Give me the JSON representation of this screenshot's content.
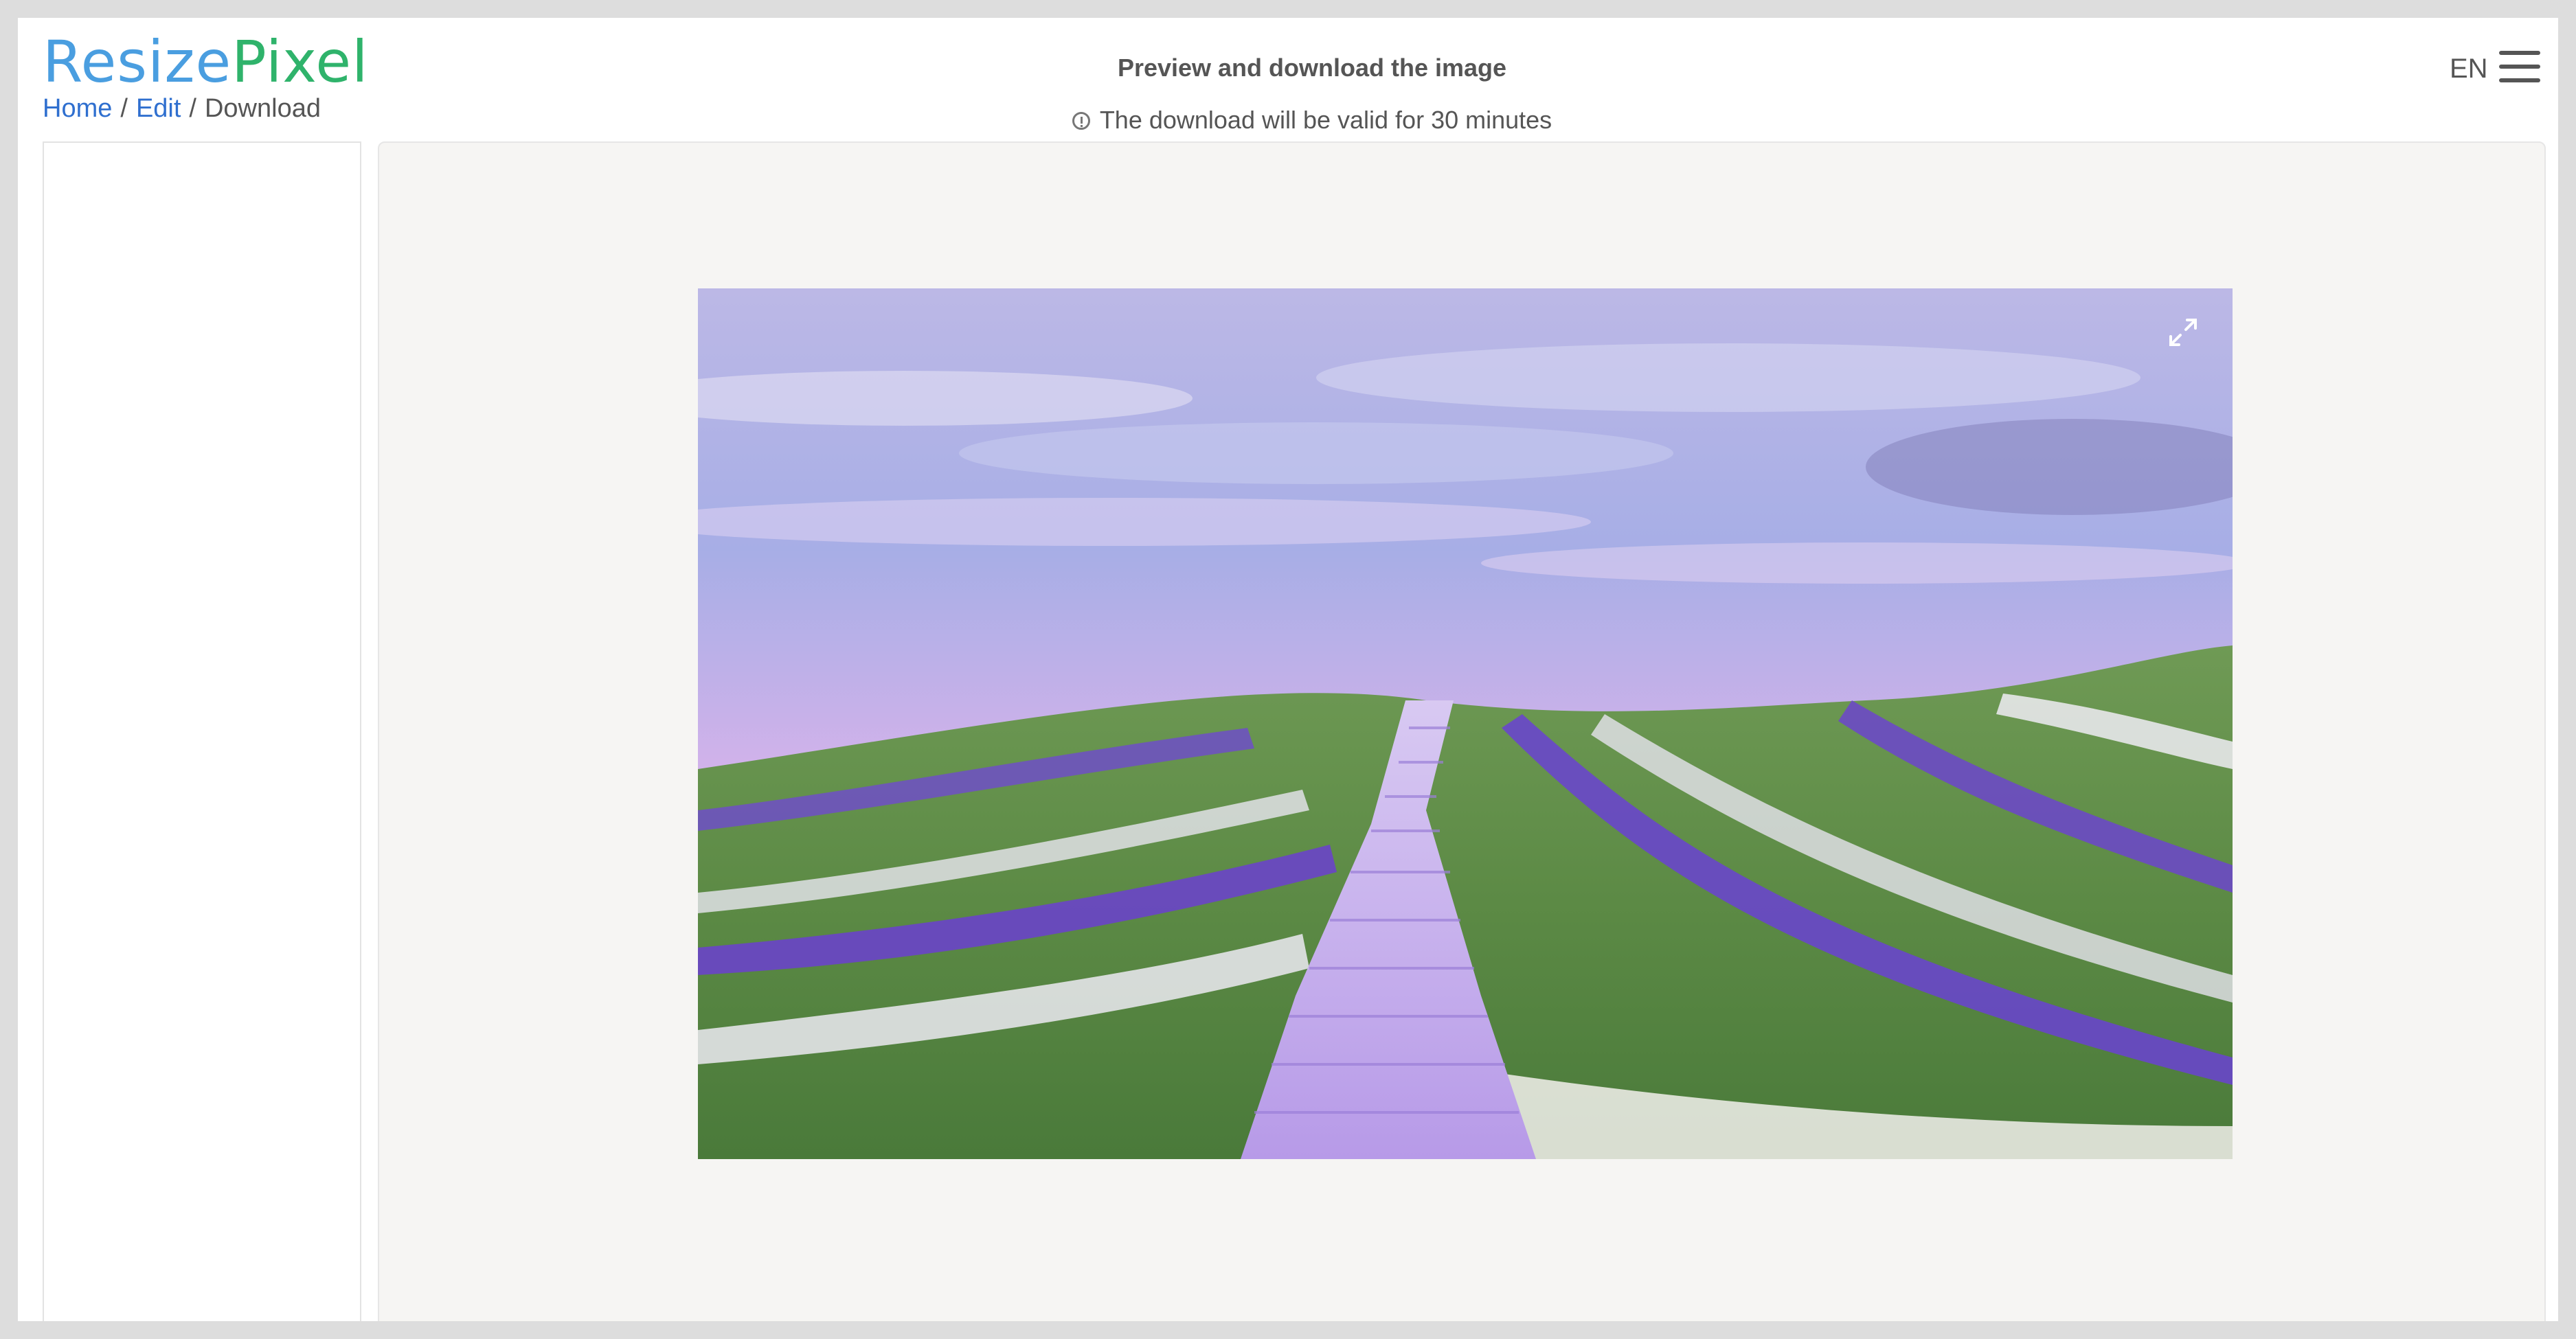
{
  "brand": {
    "part1": "Resize",
    "part2": "Pixel"
  },
  "breadcrumb": {
    "home": "Home",
    "edit": "Edit",
    "current": "Download",
    "separator": "/"
  },
  "header": {
    "title": "Preview and download the image",
    "validity": "The download will be valid for 30 minutes",
    "language": "EN"
  },
  "icons": {
    "info": "info-icon",
    "menu": "hamburger-menu-icon",
    "expand": "expand-icon"
  },
  "colors": {
    "brand_blue": "#4a9ee0",
    "brand_green": "#2fb36b",
    "link": "#2f6fcf",
    "panel_bg": "#f6f5f3"
  }
}
